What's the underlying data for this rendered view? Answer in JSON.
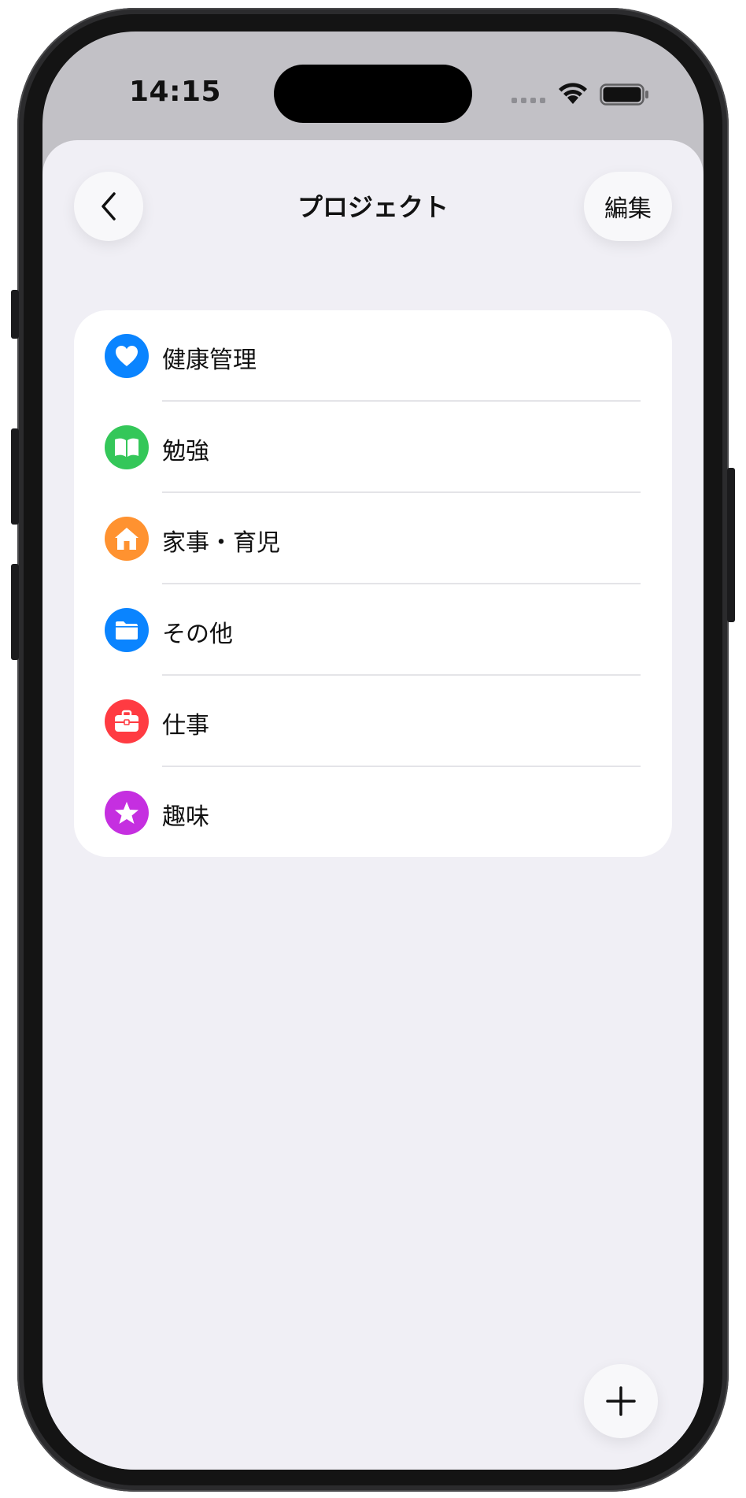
{
  "status_bar": {
    "time": "14:15"
  },
  "nav": {
    "title": "プロジェクト",
    "edit_label": "編集",
    "back_icon": "chevron-left-icon"
  },
  "projects": [
    {
      "label": "健康管理",
      "icon": "heart-icon",
      "color": "#0a84ff"
    },
    {
      "label": "勉強",
      "icon": "book-icon",
      "color": "#34c759"
    },
    {
      "label": "家事・育児",
      "icon": "house-icon",
      "color": "#ff9230"
    },
    {
      "label": "その他",
      "icon": "folder-icon",
      "color": "#0a84ff"
    },
    {
      "label": "仕事",
      "icon": "briefcase-icon",
      "color": "#ff3b42"
    },
    {
      "label": "趣味",
      "icon": "star-icon",
      "color": "#c52fe0"
    }
  ],
  "fab": {
    "icon": "plus-icon"
  }
}
